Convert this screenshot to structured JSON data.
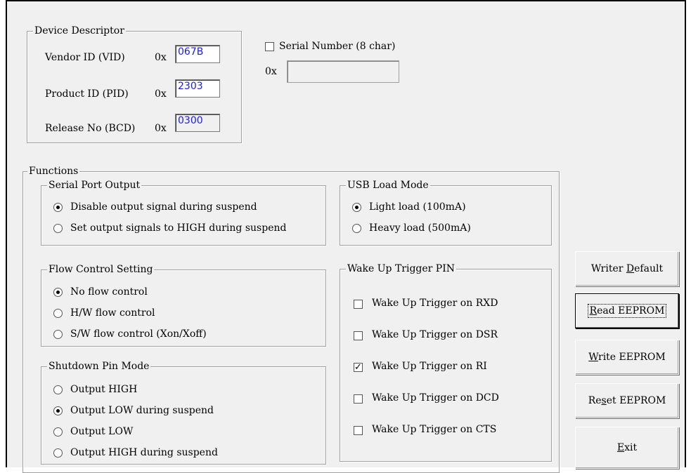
{
  "device_descriptor": {
    "legend": "Device Descriptor",
    "vid_label": "Vendor ID (VID)",
    "vid_prefix": "0x",
    "vid_value": "067B",
    "pid_label": "Product ID (PID)",
    "pid_prefix": "0x",
    "pid_value": "2303",
    "rel_label": "Release No (BCD)",
    "rel_prefix": "0x",
    "rel_value": "0300"
  },
  "serial": {
    "label": "Serial Number (8 char)",
    "checked": false,
    "prefix": "0x",
    "value": ""
  },
  "functions": {
    "legend": "Functions",
    "serial_port_output": {
      "legend": "Serial Port Output",
      "options": [
        {
          "label": "Disable output signal during suspend",
          "selected": true
        },
        {
          "label": "Set output signals to HIGH during suspend",
          "selected": false
        }
      ]
    },
    "usb_load_mode": {
      "legend": "USB Load Mode",
      "options": [
        {
          "label": "Light load (100mA)",
          "selected": true
        },
        {
          "label": "Heavy load (500mA)",
          "selected": false
        }
      ]
    },
    "flow_control": {
      "legend": "Flow Control Setting",
      "options": [
        {
          "label": "No flow control",
          "selected": true
        },
        {
          "label": "H/W flow control",
          "selected": false
        },
        {
          "label": "S/W flow control (Xon/Xoff)",
          "selected": false
        }
      ]
    },
    "wake_up": {
      "legend": "Wake Up Trigger PIN",
      "options": [
        {
          "label": "Wake Up Trigger on RXD",
          "checked": false
        },
        {
          "label": "Wake Up Trigger on DSR",
          "checked": false
        },
        {
          "label": "Wake Up Trigger on RI",
          "checked": true
        },
        {
          "label": "Wake Up Trigger on DCD",
          "checked": false
        },
        {
          "label": "Wake Up Trigger on CTS",
          "checked": false
        }
      ]
    },
    "shutdown_pin": {
      "legend": "Shutdown Pin Mode",
      "options": [
        {
          "label": "Output HIGH",
          "selected": false
        },
        {
          "label": "Output LOW during suspend",
          "selected": true
        },
        {
          "label": "Output LOW",
          "selected": false
        },
        {
          "label": "Output HIGH during suspend",
          "selected": false
        }
      ]
    }
  },
  "buttons": {
    "writer_default": {
      "pre": "Writer ",
      "key": "D",
      "post": "efault"
    },
    "read_eeprom": {
      "pre": "",
      "key": "R",
      "post": "ead EEPROM"
    },
    "write_eeprom": {
      "pre": "",
      "key": "W",
      "post": "rite EEPROM"
    },
    "reset_eeprom": {
      "pre": "Re",
      "key": "s",
      "post": "et EEPROM"
    },
    "exit": {
      "pre": "",
      "key": "E",
      "post": "xit"
    }
  },
  "colors": {
    "hex_text": "#1a1aff",
    "window_bg": "#f0f0f0"
  }
}
